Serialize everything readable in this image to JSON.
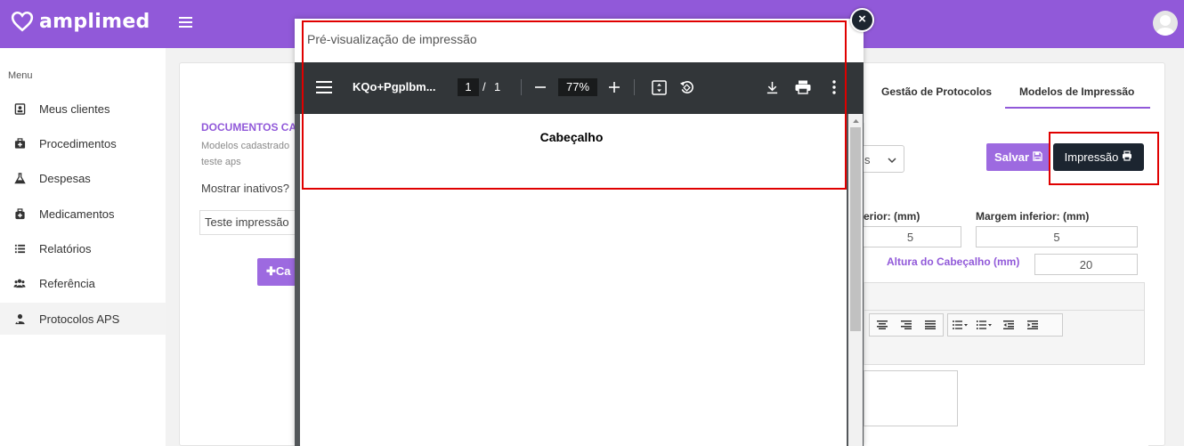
{
  "brand": {
    "name": "amplimed",
    "color": "#9159d9"
  },
  "sidebar": {
    "menu_title": "Menu",
    "items": [
      {
        "label": "Meus clientes",
        "icon": "id-card-icon"
      },
      {
        "label": "Procedimentos",
        "icon": "medkit-icon"
      },
      {
        "label": "Despesas",
        "icon": "flask-icon"
      },
      {
        "label": "Medicamentos",
        "icon": "medicine-bag-icon"
      },
      {
        "label": "Relatórios",
        "icon": "list-icon"
      },
      {
        "label": "Referência",
        "icon": "users-icon"
      },
      {
        "label": "Protocolos APS",
        "icon": "user-md-icon",
        "active": true
      }
    ]
  },
  "documents": {
    "title": "DOCUMENTOS CA",
    "subtitle": "Modelos cadastrado",
    "subtitle2": "teste aps",
    "show_inactive_label": "Mostrar inativos?",
    "list_value": "Teste impressão",
    "add_button": "Ca"
  },
  "tabs": [
    {
      "label": "Gestão de Protocolos",
      "active": false
    },
    {
      "label": "Modelos de Impressão",
      "active": true
    }
  ],
  "form": {
    "select_partial": "s",
    "save_label": "Salvar",
    "print_label": "Impressão",
    "margin_superior_label": "erior: (mm)",
    "margin_superior_value": "5",
    "margin_inferior_label": "Margem inferior: (mm)",
    "margin_inferior_value": "5",
    "header_height_label": "Altura do Cabeçalho (mm)",
    "header_height_value": "20"
  },
  "modal": {
    "title": "Pré-visualização de impressão",
    "close_label": "×",
    "pdf": {
      "filename": "KQo+Pgplbm...",
      "page_current": "1",
      "page_separator": "/",
      "page_total": "1",
      "zoom": "77%",
      "heading": "Cabeçalho"
    }
  }
}
